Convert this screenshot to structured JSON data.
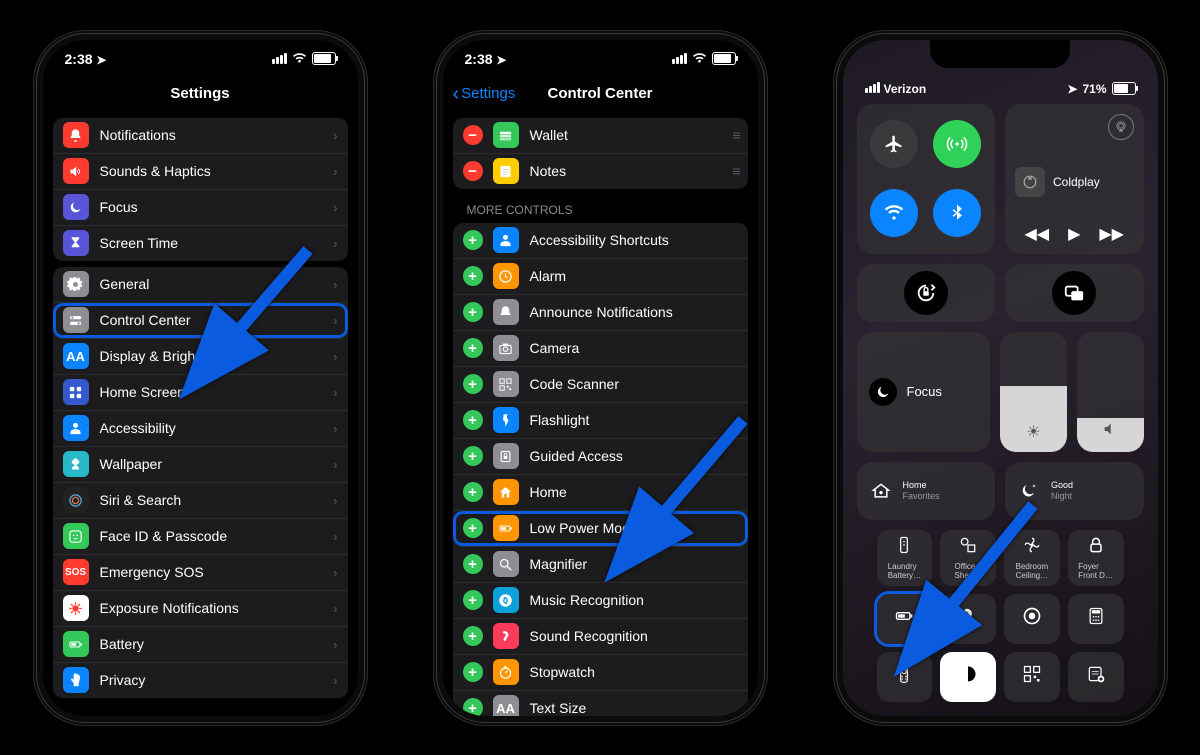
{
  "phone1": {
    "status": {
      "time": "2:38",
      "loc": "➤"
    },
    "nav_title": "Settings",
    "group1": [
      {
        "label": "Notifications",
        "name": "settings-row-notifications",
        "icon": "bell",
        "bg": "#ff3b30"
      },
      {
        "label": "Sounds & Haptics",
        "name": "settings-row-sounds",
        "icon": "speaker",
        "bg": "#ff3b30"
      },
      {
        "label": "Focus",
        "name": "settings-row-focus",
        "icon": "moon",
        "bg": "#5856d6"
      },
      {
        "label": "Screen Time",
        "name": "settings-row-screen-time",
        "icon": "hourglass",
        "bg": "#5856d6"
      }
    ],
    "group2": [
      {
        "label": "General",
        "name": "settings-row-general",
        "icon": "gear",
        "bg": "#8e8e93"
      },
      {
        "label": "Control Center",
        "name": "settings-row-control-center",
        "icon": "toggles",
        "bg": "#8e8e93",
        "highlight": true
      },
      {
        "label": "Display & Brightness",
        "name": "settings-row-display",
        "icon": "aa",
        "bg": "#0a84ff"
      },
      {
        "label": "Home Screen",
        "name": "settings-row-home-screen",
        "icon": "grid",
        "bg": "#3759d0"
      },
      {
        "label": "Accessibility",
        "name": "settings-row-accessibility",
        "icon": "person",
        "bg": "#0a84ff"
      },
      {
        "label": "Wallpaper",
        "name": "settings-row-wallpaper",
        "icon": "flower",
        "bg": "#28b8c8"
      },
      {
        "label": "Siri & Search",
        "name": "settings-row-siri",
        "icon": "siri",
        "bg": "#222"
      },
      {
        "label": "Face ID & Passcode",
        "name": "settings-row-faceid",
        "icon": "face",
        "bg": "#34c759"
      },
      {
        "label": "Emergency SOS",
        "name": "settings-row-sos",
        "icon": "sos",
        "bg": "#ff3b30"
      },
      {
        "label": "Exposure Notifications",
        "name": "settings-row-exposure",
        "icon": "virus",
        "bg": "#ffffff",
        "fg": "#ff3b30"
      },
      {
        "label": "Battery",
        "name": "settings-row-battery",
        "icon": "battery",
        "bg": "#34c759"
      },
      {
        "label": "Privacy",
        "name": "settings-row-privacy",
        "icon": "hand",
        "bg": "#0a84ff"
      }
    ]
  },
  "phone2": {
    "status": {
      "time": "2:38",
      "loc": "➤"
    },
    "back_label": "Settings",
    "nav_title": "Control Center",
    "included": [
      {
        "label": "Wallet",
        "name": "cc-included-wallet",
        "icon": "wallet",
        "bg": "#34c759"
      },
      {
        "label": "Notes",
        "name": "cc-included-notes",
        "icon": "notes",
        "bg": "#ffcc00"
      }
    ],
    "more_header": "More Controls",
    "more": [
      {
        "label": "Accessibility Shortcuts",
        "name": "cc-more-accessibility",
        "icon": "person",
        "bg": "#0a84ff"
      },
      {
        "label": "Alarm",
        "name": "cc-more-alarm",
        "icon": "clock",
        "bg": "#ff9500"
      },
      {
        "label": "Announce Notifications",
        "name": "cc-more-announce",
        "icon": "bell-w",
        "bg": "#8e8e93"
      },
      {
        "label": "Camera",
        "name": "cc-more-camera",
        "icon": "camera",
        "bg": "#8e8e93"
      },
      {
        "label": "Code Scanner",
        "name": "cc-more-code",
        "icon": "qr",
        "bg": "#8e8e93"
      },
      {
        "label": "Flashlight",
        "name": "cc-more-flashlight",
        "icon": "torch",
        "bg": "#0a84ff"
      },
      {
        "label": "Guided Access",
        "name": "cc-more-guided",
        "icon": "lock-app",
        "bg": "#8e8e93"
      },
      {
        "label": "Home",
        "name": "cc-more-home",
        "icon": "home",
        "bg": "#ff9500"
      },
      {
        "label": "Low Power Mode",
        "name": "cc-more-low-power",
        "icon": "battery",
        "bg": "#ff9500",
        "highlight": true
      },
      {
        "label": "Magnifier",
        "name": "cc-more-magnifier",
        "icon": "search",
        "bg": "#8e8e93"
      },
      {
        "label": "Music Recognition",
        "name": "cc-more-music-rec",
        "icon": "shazam",
        "bg": "#0aa2d9"
      },
      {
        "label": "Sound Recognition",
        "name": "cc-more-sound-rec",
        "icon": "ear",
        "bg": "#ff3b5c"
      },
      {
        "label": "Stopwatch",
        "name": "cc-more-stopwatch",
        "icon": "stop-w",
        "bg": "#ff9500"
      },
      {
        "label": "Text Size",
        "name": "cc-more-text-size",
        "icon": "aa",
        "bg": "#8e8e93"
      }
    ]
  },
  "phone3": {
    "carrier": "Verizon",
    "battery_pct": "71%",
    "song": "Coldplay",
    "focus_label": "Focus",
    "row4": [
      {
        "line1": "Home",
        "line2": "Favorites",
        "icon": "home-ic",
        "name": "cc-tile-home-fav"
      },
      {
        "line1": "Good",
        "line2": "Night",
        "icon": "moon-stars",
        "name": "cc-tile-good-night"
      }
    ],
    "tiles_a": [
      {
        "line1": "Laundry",
        "line2": "Battery…",
        "icon": "remote",
        "name": "cc-tile-laundry"
      },
      {
        "line1": "Office",
        "line2": "Shapes",
        "icon": "shapes",
        "name": "cc-tile-office"
      },
      {
        "line1": "Bedroom",
        "line2": "Ceiling…",
        "icon": "fan",
        "name": "cc-tile-bedroom"
      },
      {
        "line1": "Foyer",
        "line2": "Front D…",
        "icon": "lock",
        "name": "cc-tile-foyer"
      }
    ],
    "tiles_b": [
      {
        "icon": "battery",
        "name": "cc-tile-low-power",
        "highlight": true
      },
      {
        "icon": "ear",
        "name": "cc-tile-hearing"
      },
      {
        "icon": "record",
        "name": "cc-tile-screen-record"
      },
      {
        "icon": "calc",
        "name": "cc-tile-calculator"
      }
    ],
    "tiles_c": [
      {
        "icon": "remote-tv",
        "name": "cc-tile-apple-tv"
      },
      {
        "icon": "dark-mode",
        "name": "cc-tile-dark-mode",
        "selected": true
      },
      {
        "icon": "qr",
        "name": "cc-tile-code-scanner"
      },
      {
        "icon": "note-add",
        "name": "cc-tile-quick-note"
      }
    ]
  }
}
